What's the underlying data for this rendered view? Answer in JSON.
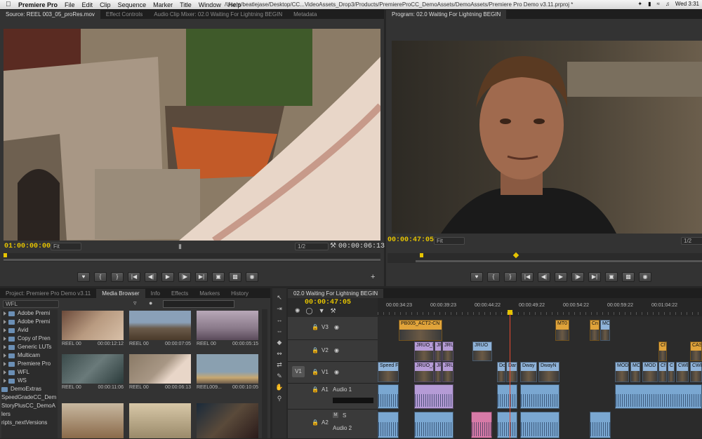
{
  "menubar": {
    "app": "Premiere Pro",
    "items": [
      "File",
      "Edit",
      "Clip",
      "Sequence",
      "Marker",
      "Title",
      "Window",
      "Help"
    ],
    "path": "/Users/beatlejase/Desktop/CC...VideoAssets_Drop3/Products/PremiereProCC_DemoAssets/DemoAssets/Premiere Pro Demo v3.11.prproj *",
    "clock": "Wed 3:31"
  },
  "source_panel": {
    "tabs": [
      "Source: REEL 003_05_proRes.mov",
      "Effect Controls",
      "Audio Clip Mixer: 02.0 Waiting For Lightning BEGIN",
      "Metadata"
    ],
    "timecode_in": "01:00:00:00",
    "fit": "Fit",
    "resolution": "1/2",
    "duration": "00:00:06:13"
  },
  "program_panel": {
    "tab": "Program: 02.0 Waiting For Lightning BEGIN",
    "timecode": "00:00:47:05",
    "fit": "Fit",
    "resolution": "1/2"
  },
  "project_panel": {
    "tabs": [
      "Project: Premiere Pro Demo v3.11",
      "Media Browser",
      "Info",
      "Effects",
      "Markers",
      "History"
    ],
    "location": "WFL",
    "tree": [
      "Adobe Premi",
      "Adobe Premi",
      "Avid",
      "Copy of Pren",
      "Generic LUTs",
      "Multicam",
      "Premiere Pro",
      "WFL",
      "WS",
      "DemoExtras",
      "SpeedGradeCC_Dem",
      "StoryPlusCC_DemoA",
      "lers",
      "ripts_nextVersions"
    ],
    "thumbs": [
      {
        "name": "REEL 00",
        "dur": "00:00:12:12"
      },
      {
        "name": "REEL 00",
        "dur": "00:00:07:05"
      },
      {
        "name": "REEL 00",
        "dur": "00:00:05:15"
      },
      {
        "name": "REEL 00",
        "dur": "00:00:11:06"
      },
      {
        "name": "REEL 00",
        "dur": "00:00:06:13"
      },
      {
        "name": "REEL009...",
        "dur": "00:00:10:05"
      }
    ]
  },
  "timeline": {
    "tab": "02.0 Waiting For Lightning BEGIN",
    "timecode": "00:00:47:05",
    "ruler": [
      "00:00:34:23",
      "00:00:39:23",
      "00:00:44:22",
      "00:00:49:22",
      "00:00:54:22",
      "00:00:59:22",
      "00:01:04:22"
    ],
    "tracks": {
      "v3": "V3",
      "v2": "V2",
      "v1": "V1",
      "a1": "A1",
      "a2": "A2",
      "v1_src": "V1",
      "a1_name": "Audio 1",
      "a2_name": "Audio 2",
      "m": "M",
      "s": "S"
    },
    "clips": {
      "pb005": "PB005_ACT2-CN",
      "mt0": "MT0",
      "cn": "Cn",
      "mc": "MC",
      "jruo_b": "JRUO_B",
      "jr": "JR",
      "jrux": "JRUX",
      "jruo2": "JRUO",
      "cf": "Cf",
      "cas": "CAS",
      "speed": "Speed F",
      "jruo_a": "JRUO_A",
      "dc": "Dc",
      "dar": "Dar",
      "dway": "Dway",
      "dwayn": "DwayN",
      "modi": "MODI",
      "mc2": "MC",
      "mod": "MOD",
      "cf2": "Cf",
      "c": "C",
      "cwe": "CWE",
      "cwe2": "CWE"
    }
  },
  "colors": {
    "timecode": "#e6c400",
    "video_clip": "#8fb3d9",
    "purple_clip": "#b59bd6",
    "orange_clip": "#e0a33a",
    "audio_clip": "#7aa7d1",
    "playhead": "#e84a2f"
  }
}
